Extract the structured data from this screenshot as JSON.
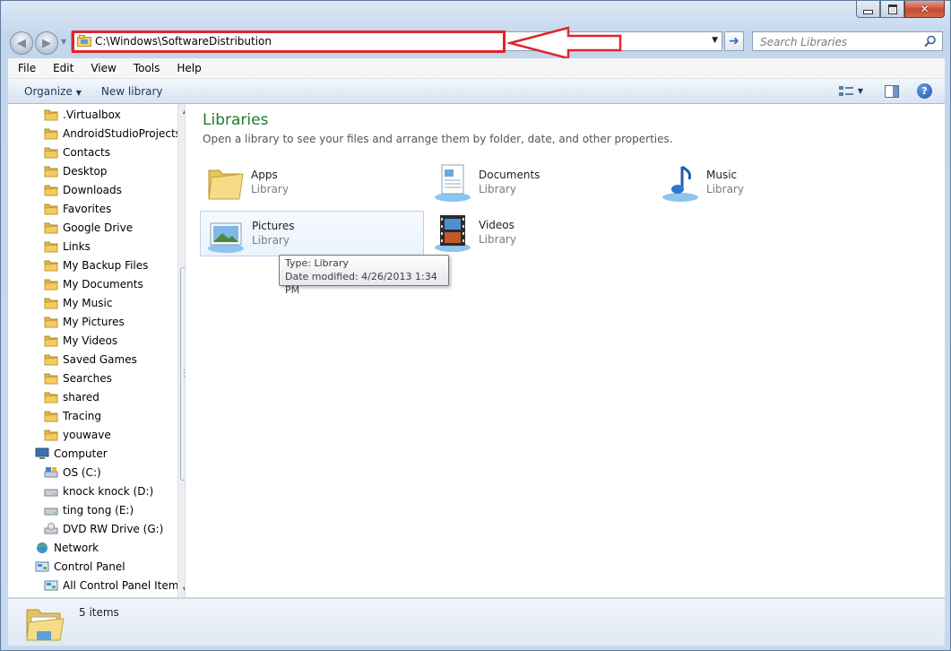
{
  "window": {
    "caption_buttons": [
      "minimize",
      "maximize",
      "close"
    ]
  },
  "address_bar": {
    "path": "C:\\Windows\\SoftwareDistribution",
    "highlight_color": "#e0252b"
  },
  "search": {
    "placeholder": "Search Libraries"
  },
  "menu": [
    "File",
    "Edit",
    "View",
    "Tools",
    "Help"
  ],
  "toolbar": {
    "organize": "Organize",
    "new_library": "New library"
  },
  "navigation": {
    "items": [
      {
        "label": ".Virtualbox",
        "icon": "folder-icon"
      },
      {
        "label": "AndroidStudioProjects",
        "icon": "folder-icon"
      },
      {
        "label": "Contacts",
        "icon": "contacts-folder-icon"
      },
      {
        "label": "Desktop",
        "icon": "desktop-folder-icon"
      },
      {
        "label": "Downloads",
        "icon": "downloads-folder-icon"
      },
      {
        "label": "Favorites",
        "icon": "favorites-folder-icon"
      },
      {
        "label": "Google Drive",
        "icon": "folder-icon"
      },
      {
        "label": "Links",
        "icon": "links-folder-icon"
      },
      {
        "label": "My Backup Files",
        "icon": "folder-icon"
      },
      {
        "label": "My Documents",
        "icon": "documents-folder-icon"
      },
      {
        "label": "My Music",
        "icon": "music-folder-icon"
      },
      {
        "label": "My Pictures",
        "icon": "pictures-folder-icon"
      },
      {
        "label": "My Videos",
        "icon": "videos-folder-icon"
      },
      {
        "label": "Saved Games",
        "icon": "saved-games-folder-icon"
      },
      {
        "label": "Searches",
        "icon": "searches-folder-icon"
      },
      {
        "label": "shared",
        "icon": "folder-icon"
      },
      {
        "label": "Tracing",
        "icon": "folder-icon"
      },
      {
        "label": "youwave",
        "icon": "folder-icon"
      },
      {
        "label": "Computer",
        "icon": "computer-icon"
      },
      {
        "label": "OS (C:)",
        "icon": "system-drive-icon"
      },
      {
        "label": "knock knock (D:)",
        "icon": "drive-icon"
      },
      {
        "label": "ting tong (E:)",
        "icon": "drive-icon"
      },
      {
        "label": "DVD RW Drive (G:)",
        "icon": "dvd-drive-icon"
      },
      {
        "label": "Network",
        "icon": "network-icon"
      },
      {
        "label": "Control Panel",
        "icon": "control-panel-icon"
      },
      {
        "label": "All Control Panel Items",
        "icon": "control-panel-icon"
      }
    ]
  },
  "content": {
    "title": "Libraries",
    "subtitle": "Open a library to see your files and arrange them by folder, date, and other properties.",
    "libraries": [
      {
        "name": "Apps",
        "type": "Library",
        "icon": "folder-library-icon"
      },
      {
        "name": "Documents",
        "type": "Library",
        "icon": "documents-library-icon"
      },
      {
        "name": "Music",
        "type": "Library",
        "icon": "music-library-icon"
      },
      {
        "name": "Pictures",
        "type": "Library",
        "icon": "pictures-library-icon"
      },
      {
        "name": "Videos",
        "type": "Library",
        "icon": "videos-library-icon"
      }
    ],
    "tooltip": {
      "line1": "Type: Library",
      "line2": "Date modified: 4/26/2013 1:34 PM"
    }
  },
  "details": {
    "count": "5 items"
  }
}
